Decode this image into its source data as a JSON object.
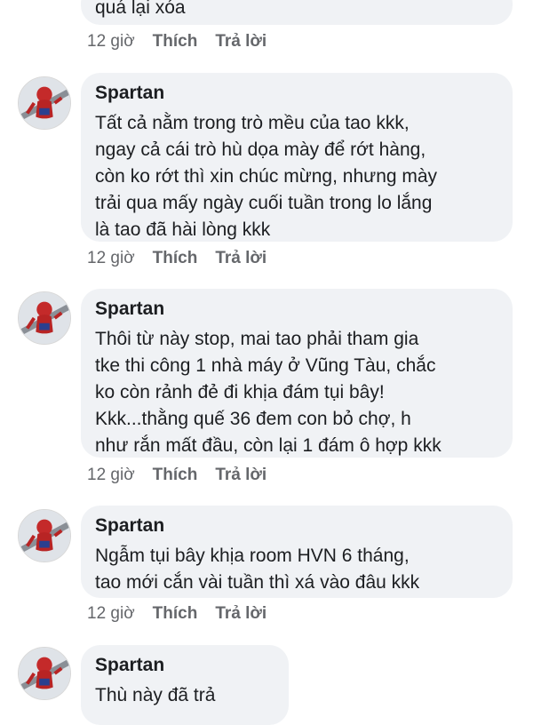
{
  "top": {
    "text_tail": "quá lại xóa",
    "time": "12 giờ",
    "like": "Thích",
    "reply": "Trả lời"
  },
  "comments": [
    {
      "author": "Spartan",
      "text": "Tất cả nằm trong trò mều của tao kkk,\nngay cả cái trò hù dọa mày để rớt hàng,\ncòn ko rớt thì xin chúc mừng, nhưng mày\ntrải qua mấy ngày cuối tuần trong lo lắng\nlà tao đã hài lòng kkk",
      "time": "12 giờ",
      "like": "Thích",
      "reply": "Trả lời"
    },
    {
      "author": "Spartan",
      "text": "Thôi từ này stop, mai tao phải tham gia\ntke thi công 1 nhà máy ở Vũng Tàu, chắc\nko còn rảnh đẻ đi khịa đám tụi bây!\nKkk...thằng quế 36 đem con bỏ chợ, h\nnhư rắn mất đầu, còn lại 1 đám ô hợp kkk",
      "time": "12 giờ",
      "like": "Thích",
      "reply": "Trả lời"
    },
    {
      "author": "Spartan",
      "text": "Ngẫm tụi bây khịa room HVN 6 tháng,\ntao mới cắn vài tuần thì xá vào đâu kkk",
      "time": "12 giờ",
      "like": "Thích",
      "reply": "Trả lời"
    },
    {
      "author": "Spartan",
      "text": "Thù này đã trả",
      "time": "",
      "like": "",
      "reply": ""
    }
  ],
  "colors": {
    "bubble_bg": "#f0f2f5",
    "meta_text": "#65676b",
    "text": "#1c1e21"
  },
  "icons": {
    "avatar": "spiderman-avatar-icon"
  }
}
